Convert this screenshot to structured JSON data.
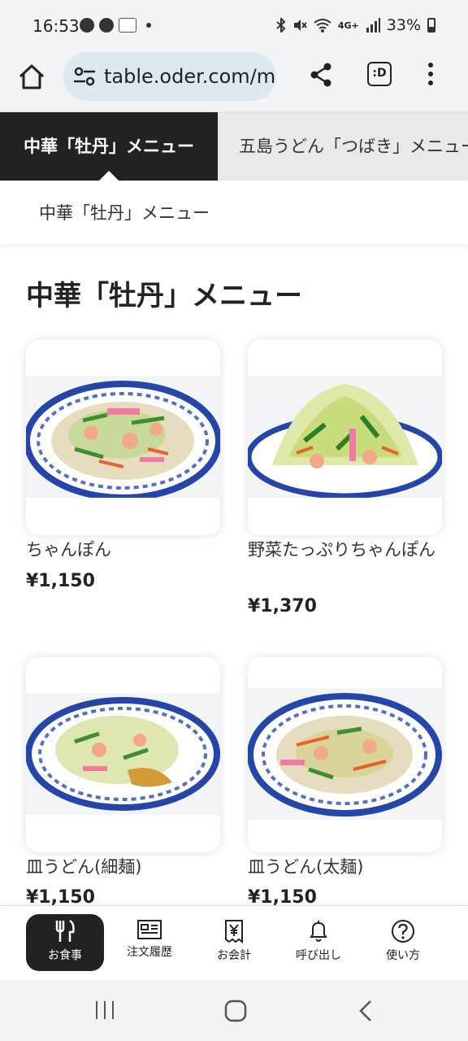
{
  "status": {
    "time": "16:53",
    "network": "4G+",
    "battery": "33%"
  },
  "browser": {
    "url": "table.oder.com/m",
    "tab_label": ":D"
  },
  "categories": [
    {
      "label": "中華「牡丹」メニュー",
      "active": true
    },
    {
      "label": "五島うどん「つばき」メニュー",
      "active": false
    }
  ],
  "subcategory": "中華「牡丹」メニュー",
  "section_title": "中華「牡丹」メニュー",
  "items": [
    {
      "name": "ちゃんぽん",
      "price": "¥1,150"
    },
    {
      "name": "野菜たっぷりちゃんぽん",
      "price": "¥1,370"
    },
    {
      "name": "皿うどん(細麺)",
      "price": "¥1,150"
    },
    {
      "name": "皿うどん(太麺)",
      "price": "¥1,150"
    }
  ],
  "bottom_nav": [
    {
      "label": "お食事",
      "icon": "fork-knife-icon",
      "active": true
    },
    {
      "label": "注文履歴",
      "icon": "receipt-list-icon",
      "active": false
    },
    {
      "label": "お会計",
      "icon": "yen-bill-icon",
      "active": false
    },
    {
      "label": "呼び出し",
      "icon": "bell-icon",
      "active": false
    },
    {
      "label": "使い方",
      "icon": "help-icon",
      "active": false
    }
  ],
  "colors": {
    "active_tab_bg": "#222222",
    "browser_bar_bg": "#f1f3f4",
    "url_pill_bg": "#dde8ef"
  }
}
